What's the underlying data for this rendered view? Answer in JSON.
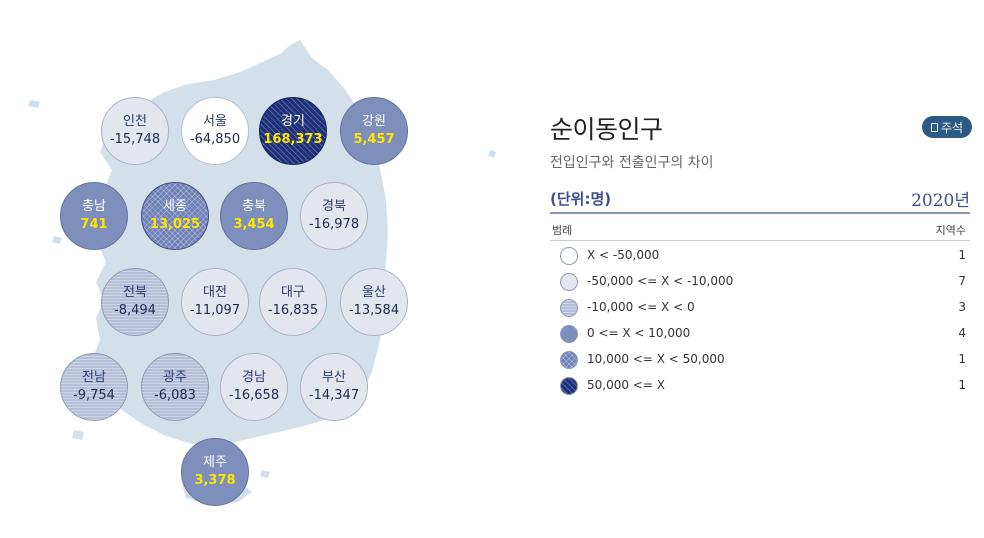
{
  "regions": [
    {
      "name": "인천",
      "value": "-15,748",
      "level": 1
    },
    {
      "name": "서울",
      "value": "-64,850",
      "level": 0
    },
    {
      "name": "경기",
      "value": "168,373",
      "level": 5
    },
    {
      "name": "강원",
      "value": "5,457",
      "level": 3
    },
    {
      "name": "충남",
      "value": "741",
      "level": 3
    },
    {
      "name": "세종",
      "value": "13,025",
      "level": 4
    },
    {
      "name": "충북",
      "value": "3,454",
      "level": 3
    },
    {
      "name": "경북",
      "value": "-16,978",
      "level": 1
    },
    {
      "name": "전북",
      "value": "-8,494",
      "level": 2
    },
    {
      "name": "대전",
      "value": "-11,097",
      "level": 1
    },
    {
      "name": "대구",
      "value": "-16,835",
      "level": 1
    },
    {
      "name": "울산",
      "value": "-13,584",
      "level": 1
    },
    {
      "name": "전남",
      "value": "-9,754",
      "level": 2
    },
    {
      "name": "광주",
      "value": "-6,083",
      "level": 2
    },
    {
      "name": "경남",
      "value": "-16,658",
      "level": 1
    },
    {
      "name": "부산",
      "value": "-14,347",
      "level": 1
    },
    {
      "name": "제주",
      "value": "3,378",
      "level": 3
    }
  ],
  "panel": {
    "title": "순이동인구",
    "note_label": "주석",
    "subtitle": "전입인구와 전출인구의 차이",
    "unit": "(단위:명)",
    "year": "2020년",
    "legend_header": "범례",
    "count_header": "지역수"
  },
  "legend": [
    {
      "label": "X < -50,000",
      "count": "1",
      "level": 0
    },
    {
      "label": "-50,000 <= X < -10,000",
      "count": "7",
      "level": 1
    },
    {
      "label": "-10,000 <= X < 0",
      "count": "3",
      "level": 2
    },
    {
      "label": "0 <= X < 10,000",
      "count": "4",
      "level": 3
    },
    {
      "label": "10,000 <= X < 50,000",
      "count": "1",
      "level": 4
    },
    {
      "label": "50,000 <= X",
      "count": "1",
      "level": 5
    }
  ]
}
